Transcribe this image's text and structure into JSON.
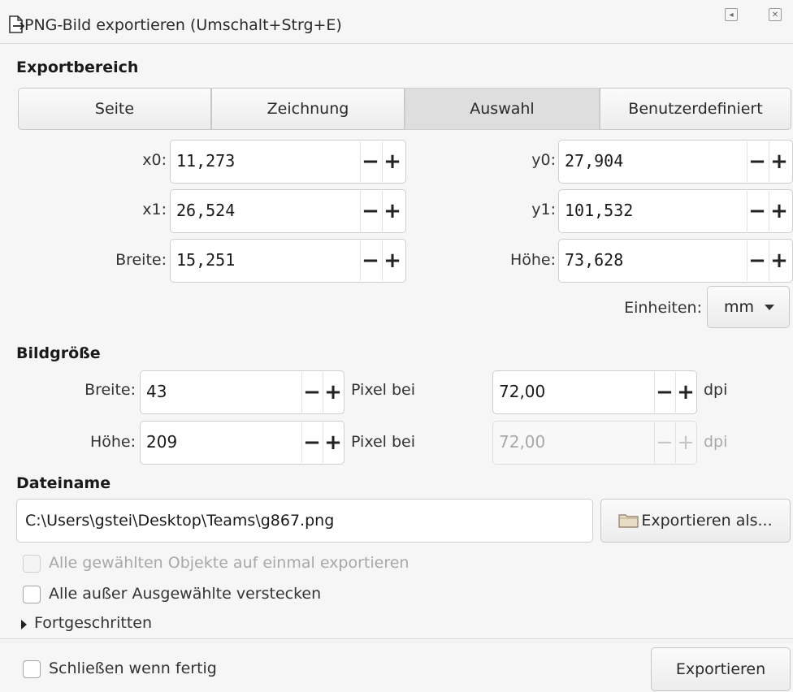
{
  "window": {
    "title": "PNG-Bild exportieren (Umschalt+Strg+E)"
  },
  "export_area": {
    "heading": "Exportbereich",
    "tabs": [
      {
        "label": "Seite",
        "active": false
      },
      {
        "label": "Zeichnung",
        "active": false
      },
      {
        "label": "Auswahl",
        "active": true
      },
      {
        "label": "Benutzerdefiniert",
        "active": false
      }
    ],
    "fields": {
      "x0": {
        "label": "x0:",
        "value": "11,273"
      },
      "y0": {
        "label": "y0:",
        "value": "27,904"
      },
      "x1": {
        "label": "x1:",
        "value": "26,524"
      },
      "y1": {
        "label": "y1:",
        "value": "101,532"
      },
      "width": {
        "label": "Breite:",
        "value": "15,251"
      },
      "height": {
        "label": "Höhe:",
        "value": "73,628"
      }
    },
    "units_label": "Einheiten:",
    "units_value": "mm"
  },
  "image_size": {
    "heading": "Bildgröße",
    "width_label": "Breite:",
    "width_value": "43",
    "height_label": "Höhe:",
    "height_value": "209",
    "pixel_at": "Pixel bei",
    "dpi_value": "72,00",
    "dpi_value_2": "72,00",
    "dpi_unit": "dpi"
  },
  "filename": {
    "heading": "Dateiname",
    "value": "C:\\Users\\gstei\\Desktop\\Teams\\g867.png",
    "export_as_label": "Exportieren als..."
  },
  "options": {
    "batch_export": {
      "label": "Alle gewählten Objekte auf einmal exportieren",
      "checked": false,
      "disabled": true
    },
    "hide_others": {
      "label": "Alle außer Ausgewählte verstecken",
      "checked": false
    },
    "advanced": "Fortgeschritten"
  },
  "footer": {
    "close_when_done": {
      "label": "Schließen wenn fertig",
      "checked": false
    },
    "export_label": "Exportieren"
  },
  "symbols": {
    "minus": "−",
    "plus": "+"
  },
  "icons": {
    "title_icon": "document-export-icon",
    "folder_icon": "folder-icon",
    "disclosure_icon": "triangle-right-icon"
  }
}
